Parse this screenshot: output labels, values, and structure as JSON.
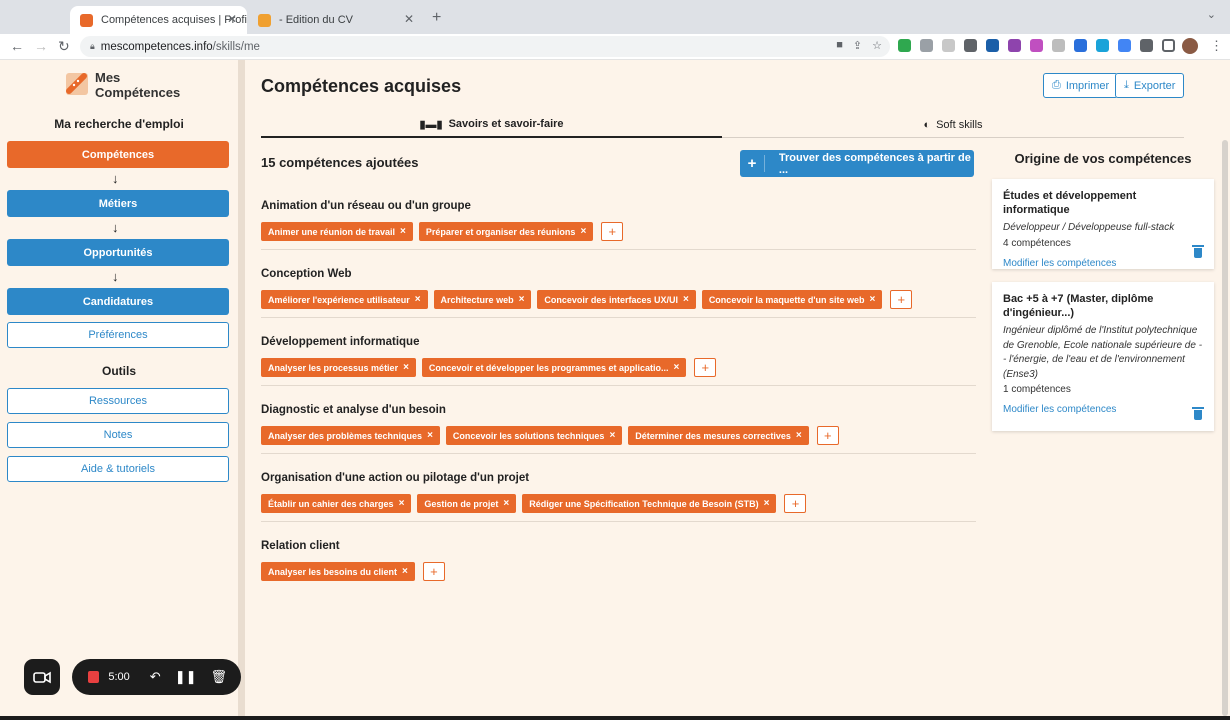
{
  "browser": {
    "tabs": [
      {
        "title": "Compétences acquises | Profil",
        "favicon_color": "#e8692a",
        "active": true
      },
      {
        "title": "- Edition du CV",
        "favicon_color": "#f0a030",
        "active": false
      }
    ],
    "url_host": "mescompetences.info",
    "url_path": "/skills/me"
  },
  "sidebar": {
    "logo_line1": "Mes",
    "logo_line2": "Compétences",
    "section_job": "Ma recherche d'emploi",
    "nav": [
      {
        "label": "Compétences",
        "style": "orange"
      },
      {
        "label": "Métiers",
        "style": "blue"
      },
      {
        "label": "Opportunités",
        "style": "blue"
      },
      {
        "label": "Candidatures",
        "style": "blue"
      }
    ],
    "arrow": "↓",
    "preferences": "Préférences",
    "section_tools": "Outils",
    "tools": [
      "Ressources",
      "Notes",
      "Aide & tutoriels"
    ]
  },
  "recorder": {
    "time": "5:00"
  },
  "main": {
    "title": "Compétences acquises",
    "print": "Imprimer",
    "export": "Exporter",
    "tab_savoirs": "Savoirs et savoir-faire",
    "tab_soft": "Soft skills",
    "count": "15 compétences ajoutées",
    "find_button": "Trouver des compétences à partir de ...",
    "categories": [
      {
        "title": "Animation d'un réseau ou d'un groupe",
        "skills": [
          "Animer une réunion de travail",
          "Préparer et organiser des réunions"
        ]
      },
      {
        "title": "Conception Web",
        "skills": [
          "Améliorer l'expérience utilisateur",
          "Architecture web",
          "Concevoir des interfaces UX/UI",
          "Concevoir la maquette d'un site web"
        ]
      },
      {
        "title": "Développement informatique",
        "skills": [
          "Analyser les processus métier",
          "Concevoir et développer les programmes et applicatio..."
        ]
      },
      {
        "title": "Diagnostic et analyse d'un besoin",
        "skills": [
          "Analyser des problèmes techniques",
          "Concevoir les solutions techniques",
          "Déterminer des mesures correctives"
        ]
      },
      {
        "title": "Organisation d'une action ou pilotage d'un projet",
        "skills": [
          "Établir un cahier des charges",
          "Gestion de projet",
          "Rédiger une Spécification Technique de Besoin (STB)"
        ]
      },
      {
        "title": "Relation client",
        "skills": [
          "Analyser les besoins du client"
        ]
      }
    ],
    "chip_remove": "×",
    "add_symbol": "+"
  },
  "origins": {
    "title": "Origine de vos compétences",
    "cards": [
      {
        "title": "Études et développement informatique",
        "subtitle": "Développeur / Développeuse full-stack",
        "count": "4 compétences",
        "link": "Modifier les compétences"
      },
      {
        "title": "Bac +5 à +7 (Master, diplôme d'ingénieur...)",
        "subtitle": "Ingénieur diplômé de l'Institut polytechnique de Grenoble, Ecole nationale supérieure de -- l'énergie, de l'eau et de l'environnement (Ense3)",
        "count": "1 compétences",
        "link": "Modifier les compétences"
      }
    ]
  },
  "colors": {
    "accent_orange": "#e8692a",
    "accent_blue": "#2d88c8",
    "background": "#fdf4ea"
  }
}
